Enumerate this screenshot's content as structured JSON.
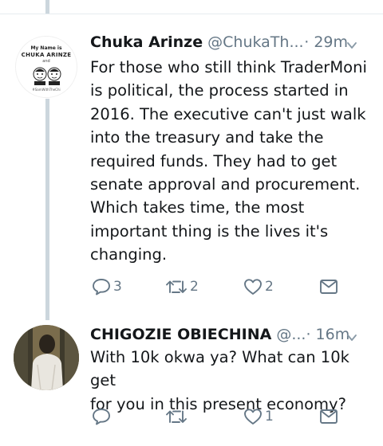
{
  "tweets": [
    {
      "avatar": {
        "line1": "My Name is",
        "line2": "CHUKA ARINZE",
        "line3": "and",
        "tag": "#SamWithTheChi"
      },
      "name": "Chuka Arinze",
      "handle": "@ChukaTh...",
      "time": "· 29m",
      "lines": [
        "For those who still think TraderMoni",
        "is political, the process started in",
        "2016. The executive can't just walk",
        "into the treasury and take the",
        "required funds. They had to get",
        "senate approval and procurement.",
        "Which takes time, the most",
        "important thing is the lives it's",
        "changing."
      ],
      "replies": "3",
      "retweets": "2",
      "likes": "2",
      "dms": ""
    },
    {
      "name": "CHIGOZIE OBIECHINA",
      "handle": "@...",
      "time": "· 16m",
      "lines": [
        "With 10k okwa ya? What can 10k get",
        "for you in this present economy?"
      ],
      "replies": "",
      "retweets": "",
      "likes": "1",
      "dms": ""
    }
  ],
  "colors": {
    "text": "#14171a",
    "secondary": "#657786",
    "thread_line": "#ccd6dd"
  },
  "icons": [
    "reply-icon",
    "retweet-icon",
    "like-icon",
    "message-icon",
    "chevron-down-icon"
  ]
}
